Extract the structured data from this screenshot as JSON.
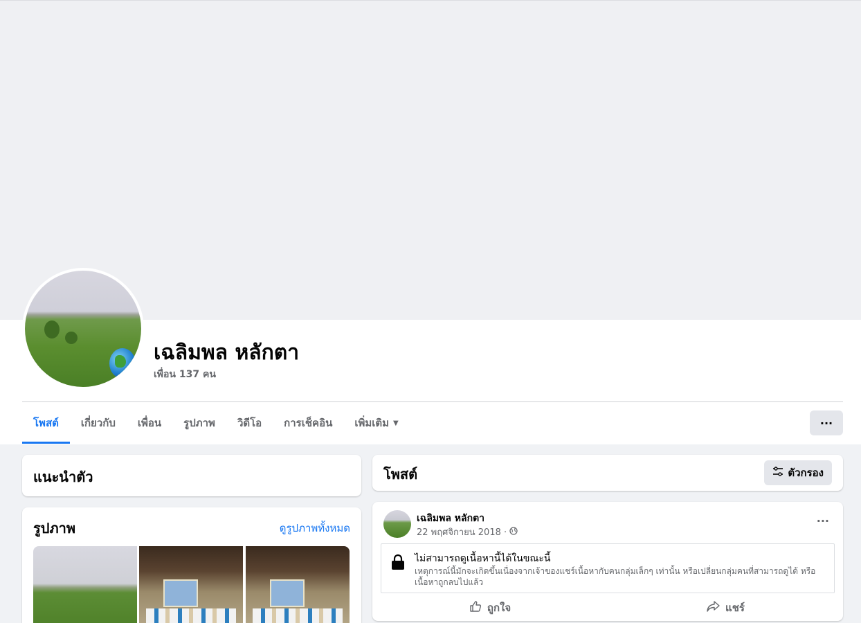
{
  "profile": {
    "name": "เฉลิมพล หลักตา",
    "friends_text": "เพื่อน 137 คน"
  },
  "tabs": [
    {
      "label": "โพสต์",
      "active": true
    },
    {
      "label": "เกี่ยวกับ",
      "active": false
    },
    {
      "label": "เพื่อน",
      "active": false
    },
    {
      "label": "รูปภาพ",
      "active": false
    },
    {
      "label": "วิดีโอ",
      "active": false
    },
    {
      "label": "การเช็คอิน",
      "active": false
    },
    {
      "label": "เพิ่มเติม",
      "active": false
    }
  ],
  "more_menu_label": "···",
  "intro": {
    "title": "แนะนำตัว"
  },
  "photos": {
    "title": "รูปภาพ",
    "see_all": "ดูรูปภาพทั้งหมด"
  },
  "posts": {
    "title": "โพสต์",
    "filter_label": "ตัวกรอง"
  },
  "post": {
    "author": "เฉลิมพล หลักตา",
    "date": "22 พฤศจิกายน 2018 ·",
    "more_label": "···",
    "unavailable_title": "ไม่สามารถดูเนื้อหานี้ได้ในขณะนี้",
    "unavailable_desc": "เหตุการณ์นี้มักจะเกิดขึ้นเนื่องจากเจ้าของแชร์เนื้อหากับคนกลุ่มเล็กๆ เท่านั้น หรือเปลี่ยนกลุ่มคนที่สามารถดูได้ หรือเนื้อหาถูกลบไปแล้ว",
    "like_label": "ถูกใจ",
    "share_label": "แชร์"
  },
  "colors": {
    "accent": "#1877f2",
    "page_bg": "#f0f2f5",
    "secondary_text": "#65676b"
  }
}
